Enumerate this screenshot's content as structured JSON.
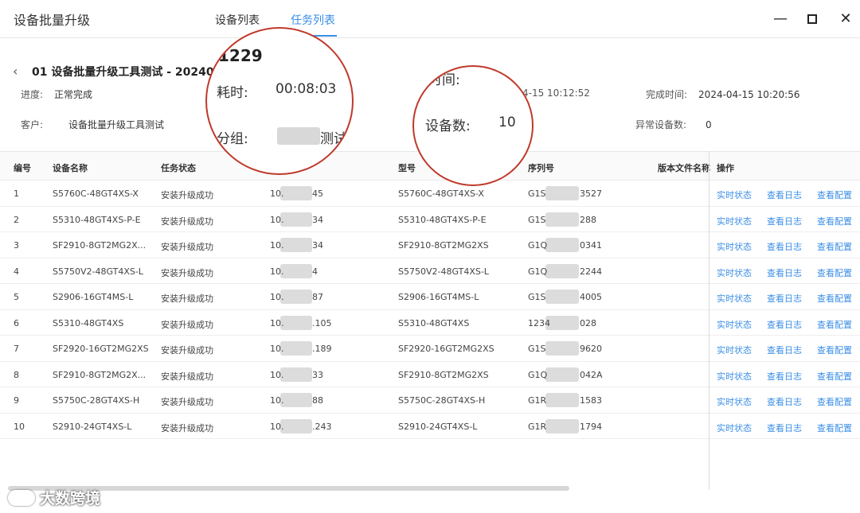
{
  "window": {
    "title": "设备批量升级",
    "tabs": [
      "设备列表",
      "任务列表"
    ],
    "controls": {
      "minimize": "—",
      "close": "✕"
    }
  },
  "task": {
    "back": "‹",
    "title": "01 设备批量升级工具测试 - 20240",
    "progress_label": "进度:",
    "progress_value": "正常完成",
    "customer_label": "客户:",
    "customer_value": "设备批量升级工具测试",
    "start_value": "4-15 10:12:52",
    "finish_label": "完成时间:",
    "finish_value": "2024-04-15 10:20:56",
    "abnormal_label": "异常设备数:",
    "abnormal_value": "0"
  },
  "zoom1": {
    "number": "1229",
    "duration_label": "耗时:",
    "duration_value": "00:08:03",
    "group_label": "分组:",
    "group_value": "测试"
  },
  "zoom2": {
    "time_fragment": "时间:",
    "count_label": "设备数:",
    "count_value": "10"
  },
  "table": {
    "headers": [
      "编号",
      "设备名称",
      "任务状态",
      "型号",
      "序列号",
      "版本文件名称",
      "操作"
    ],
    "actions": [
      "实时状态",
      "查看日志",
      "查看配置"
    ],
    "rows": [
      {
        "no": "1",
        "name": "S5760C-48GT4XS-X",
        "status": "安装升级成功",
        "ip_prefix": "10.",
        "ip_suffix": "45",
        "model": "S5760C-48GT4XS-X",
        "sn_prefix": "G1S",
        "sn_suffix": "3527"
      },
      {
        "no": "2",
        "name": "S5310-48GT4XS-P-E",
        "status": "安装升级成功",
        "ip_prefix": "10.",
        "ip_suffix": "34",
        "model": "S5310-48GT4XS-P-E",
        "sn_prefix": "G1S",
        "sn_suffix": "288"
      },
      {
        "no": "3",
        "name": "SF2910-8GT2MG2X...",
        "status": "安装升级成功",
        "ip_prefix": "10.",
        "ip_suffix": "34",
        "model": "SF2910-8GT2MG2XS",
        "sn_prefix": "G1Q",
        "sn_suffix": "0341"
      },
      {
        "no": "4",
        "name": "S5750V2-48GT4XS-L",
        "status": "安装升级成功",
        "ip_prefix": "10.",
        "ip_suffix": "4",
        "model": "S5750V2-48GT4XS-L",
        "sn_prefix": "G1Q",
        "sn_suffix": "2244"
      },
      {
        "no": "5",
        "name": "S2906-16GT4MS-L",
        "status": "安装升级成功",
        "ip_prefix": "10.",
        "ip_suffix": "87",
        "model": "S2906-16GT4MS-L",
        "sn_prefix": "G1S",
        "sn_suffix": "4005"
      },
      {
        "no": "6",
        "name": "S5310-48GT4XS",
        "status": "安装升级成功",
        "ip_prefix": "10.",
        "ip_suffix": ".105",
        "model": "S5310-48GT4XS",
        "sn_prefix": "1234",
        "sn_suffix": "028"
      },
      {
        "no": "7",
        "name": "SF2920-16GT2MG2XS",
        "status": "安装升级成功",
        "ip_prefix": "10.",
        "ip_suffix": ".189",
        "model": "SF2920-16GT2MG2XS",
        "sn_prefix": "G1S",
        "sn_suffix": "9620"
      },
      {
        "no": "8",
        "name": "SF2910-8GT2MG2X...",
        "status": "安装升级成功",
        "ip_prefix": "10.",
        "ip_suffix": "33",
        "model": "SF2910-8GT2MG2XS",
        "sn_prefix": "G1Q",
        "sn_suffix": "042A"
      },
      {
        "no": "9",
        "name": "S5750C-28GT4XS-H",
        "status": "安装升级成功",
        "ip_prefix": "10.",
        "ip_suffix": "88",
        "model": "S5750C-28GT4XS-H",
        "sn_prefix": "G1R",
        "sn_suffix": "1583"
      },
      {
        "no": "10",
        "name": "S2910-24GT4XS-L",
        "status": "安装升级成功",
        "ip_prefix": "10.",
        "ip_suffix": ".243",
        "model": "S2910-24GT4XS-L",
        "sn_prefix": "G1R",
        "sn_suffix": "1794"
      }
    ]
  },
  "watermark": "大数跨境",
  "colors": {
    "accent": "#3a8ee6",
    "highlight_circle": "#c0392b"
  }
}
